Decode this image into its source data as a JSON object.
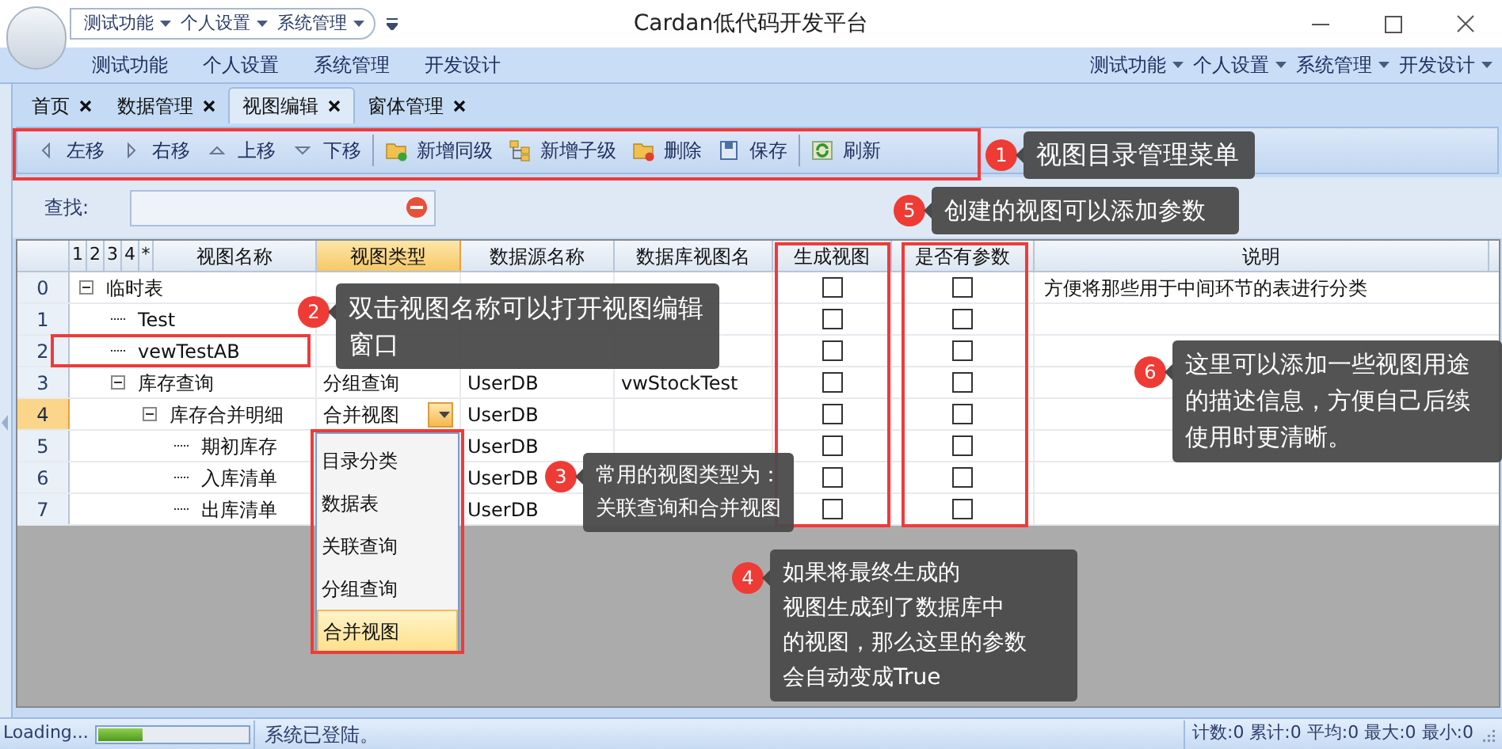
{
  "window": {
    "title": "Cardan低代码开发平台"
  },
  "quick_access": [
    "测试功能",
    "个人设置",
    "系统管理"
  ],
  "menu_left": [
    "测试功能",
    "个人设置",
    "系统管理",
    "开发设计"
  ],
  "menu_right": [
    "测试功能",
    "个人设置",
    "系统管理",
    "开发设计"
  ],
  "tabs": [
    {
      "label": "首页",
      "selected": false
    },
    {
      "label": "数据管理",
      "selected": false
    },
    {
      "label": "视图编辑",
      "selected": true
    },
    {
      "label": "窗体管理",
      "selected": false
    }
  ],
  "toolbar": [
    "左移",
    "右移",
    "上移",
    "下移",
    "新增同级",
    "新增子级",
    "删除",
    "保存",
    "刷新"
  ],
  "search": {
    "label": "查找:"
  },
  "grid": {
    "level_buttons": [
      "1",
      "2",
      "3",
      "4",
      "*"
    ],
    "columns": [
      {
        "label": "视图名称",
        "selected": false
      },
      {
        "label": "视图类型",
        "selected": true
      },
      {
        "label": "数据源名称",
        "selected": false
      },
      {
        "label": "数据库视图名",
        "selected": false
      },
      {
        "label": "生成视图",
        "selected": false
      },
      {
        "label": "是否有参数",
        "selected": false
      },
      {
        "label": "说明",
        "selected": false
      }
    ],
    "rows": [
      {
        "row_number": "0",
        "name": "临时表",
        "expanded": true,
        "selected": false,
        "generate_view": false,
        "has_params": false,
        "description": "方便将那些用于中间环节的表进行分类",
        "children": [
          {
            "row_number": "1",
            "name": "Test",
            "selected": false,
            "generate_view": false,
            "has_params": false
          },
          {
            "row_number": "2",
            "name": "vewTestAB",
            "selected": false,
            "generate_view": false,
            "has_params": false
          },
          {
            "row_number": "3",
            "name": "库存查询",
            "type": "分组查询",
            "source": "UserDB",
            "db_view": "vwStockTest",
            "expanded": true,
            "selected": false,
            "generate_view": false,
            "has_params": false,
            "children": [
              {
                "row_number": "4",
                "name": "库存合并明细",
                "type": "合并视图",
                "source": "UserDB",
                "expanded": true,
                "selected": true,
                "generate_view": false,
                "has_params": false,
                "children": [
                  {
                    "row_number": "5",
                    "name": "期初库存",
                    "source": "UserDB",
                    "selected": false,
                    "generate_view": false,
                    "has_params": false
                  },
                  {
                    "row_number": "6",
                    "name": "入库清单",
                    "source": "UserDB",
                    "selected": false,
                    "generate_view": false,
                    "has_params": false
                  },
                  {
                    "row_number": "7",
                    "name": "出库清单",
                    "source": "UserDB",
                    "selected": false,
                    "generate_view": false,
                    "has_params": false
                  }
                ]
              }
            ]
          }
        ]
      }
    ]
  },
  "type_dropdown": [
    {
      "label": "目录分类",
      "selected": false
    },
    {
      "label": "数据表",
      "selected": false
    },
    {
      "label": "关联查询",
      "selected": false
    },
    {
      "label": "分组查询",
      "selected": false
    },
    {
      "label": "合并视图",
      "selected": true
    }
  ],
  "callouts": [
    {
      "number": "1",
      "lines": [
        "视图目录管理菜单"
      ]
    },
    {
      "number": "5",
      "lines": [
        "创建的视图可以添加参数"
      ]
    },
    {
      "number": "2",
      "lines": [
        "双击视图名称可以打开视图编辑",
        "窗口"
      ]
    },
    {
      "number": "6",
      "lines": [
        "这里可以添加一些视图用途",
        "的描述信息，方便自己后续",
        "使用时更清晰。"
      ]
    },
    {
      "number": "3",
      "lines": [
        "常用的视图类型为：",
        "关联查询和合并视图"
      ]
    },
    {
      "number": "4",
      "lines": [
        "如果将最终生成的",
        "视图生成到了数据库中",
        "的视图，那么这里的参数",
        "会自动变成True"
      ]
    }
  ],
  "status_bar": {
    "loading": "Loading...",
    "level": 0.3,
    "message": "系统已登陆。",
    "stats": "计数:0 累计:0 平均:0 最大:0 最小:0"
  }
}
